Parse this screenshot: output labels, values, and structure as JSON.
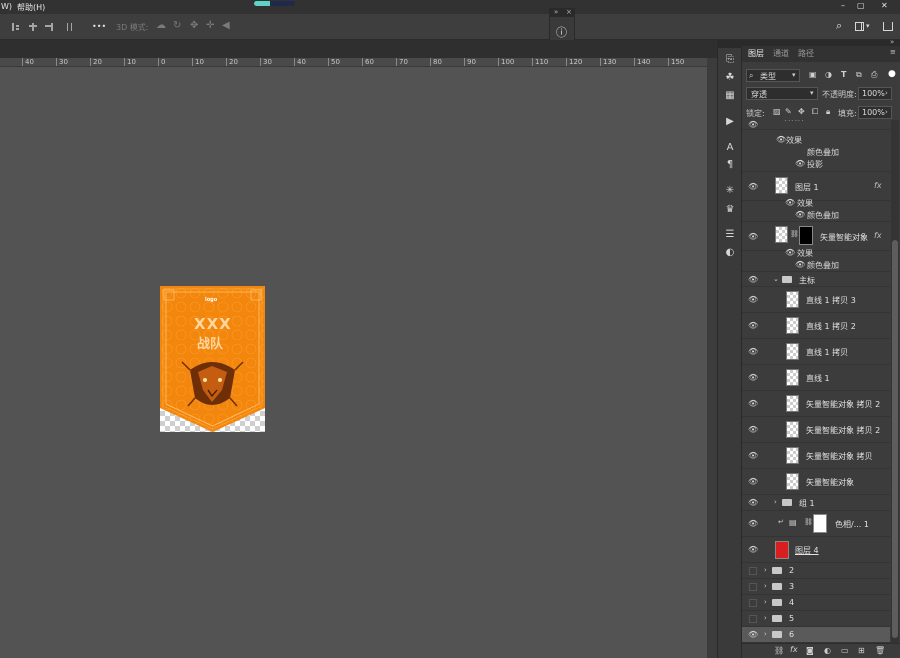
{
  "menubar": {
    "item1": "W)",
    "item2": "帮助(H)",
    "win_min": "–",
    "win_max": "▢",
    "win_close": "✕"
  },
  "options": {
    "mode_3d": "3D 模式:",
    "more": "•••"
  },
  "float_panel": {
    "info_icon": "ⓘ",
    "collapse": "»",
    "close": "×"
  },
  "ruler_ticks": [
    "40",
    "30",
    "20",
    "10",
    "0",
    "10",
    "20",
    "30",
    "40",
    "50",
    "60",
    "70",
    "80",
    "90",
    "100",
    "110",
    "120",
    "130",
    "140",
    "150"
  ],
  "panel": {
    "tabs": [
      "图层",
      "通道",
      "路径"
    ],
    "filter_kind": "类型",
    "blend_mode": "穿透",
    "opacity_label": "不透明度:",
    "opacity_value": "100%",
    "lock_label": "锁定:",
    "fill_label": "填充:",
    "fill_value": "100%"
  },
  "poster": {
    "logo": "logo",
    "line1": "XXX",
    "line2": "战队",
    "accent": "#f3860c"
  },
  "layers": {
    "top_partial_name": "^^^",
    "effects": "效果",
    "color_overlay": "颜色叠加",
    "drop_shadow": "投影",
    "layer1": "图层 1",
    "smart_obj": "矢量智能对象",
    "group_main": "主标",
    "line1_copy3": "直线 1 拷贝 3",
    "line1_copy2": "直线 1 拷贝 2",
    "line1_copy": "直线 1 拷贝",
    "line1": "直线 1",
    "so_copy2a": "矢量智能对象 拷贝 2",
    "so_copy2b": "矢量智能对象 拷贝 2",
    "so_copy": "矢量智能对象 拷贝",
    "so": "矢量智能对象",
    "group1": "组 1",
    "color_layer": "色相/... 1",
    "layer4": "图层 4",
    "g2": "2",
    "g3": "3",
    "g4": "4",
    "g5": "5",
    "g6": "6",
    "fx": "fx"
  },
  "bottom_icons": [
    "link-icon",
    "fx-icon",
    "mask-icon",
    "adjust-icon",
    "folder-icon",
    "new-layer-icon",
    "trash-icon"
  ]
}
